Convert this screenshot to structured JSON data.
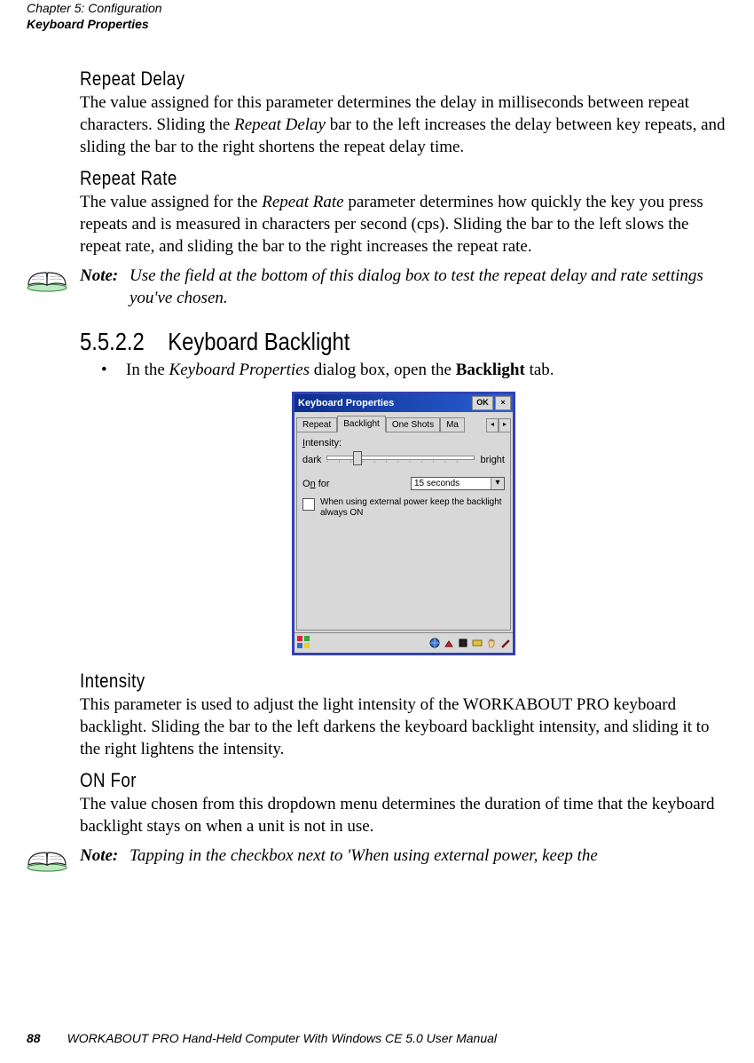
{
  "header": {
    "line1": "Chapter 5: Configuration",
    "line2": "Keyboard Properties"
  },
  "repeat_delay": {
    "heading": "Repeat Delay",
    "p1a": "The value assigned for this parameter determines the delay in milliseconds between repeat characters. Sliding the ",
    "p1_em": "Repeat Delay",
    "p1b": " bar to the left increases the delay between key repeats, and sliding the bar to the right shortens the repeat delay time."
  },
  "repeat_rate": {
    "heading": "Repeat Rate",
    "p1a": "The value assigned for the ",
    "p1_em": "Repeat Rate",
    "p1b": " parameter determines how quickly the key you press repeats and is measured in characters per second (cps). Sliding the bar to the left slows the repeat rate, and sliding the bar to the right increases the repeat rate."
  },
  "note1": {
    "label": "Note:",
    "text": "Use the field at the bottom of this dialog box to test the repeat delay and rate settings you've chosen."
  },
  "backlight_section": {
    "number": "5.5.2.2",
    "title": "Keyboard Backlight",
    "bullet_a": "In the ",
    "bullet_em": "Keyboard Properties",
    "bullet_b": " dialog box, open the ",
    "bullet_bold": "Backlight",
    "bullet_c": " tab."
  },
  "dialog": {
    "title": "Keyboard Properties",
    "ok": "OK",
    "close": "×",
    "tabs": {
      "repeat": "Repeat",
      "backlight": "Backlight",
      "oneshots": "One Shots",
      "macro": "Ma"
    },
    "intensity_label": "Intensity:",
    "dark": "dark",
    "bright": "bright",
    "onfor_label_a": "O",
    "onfor_label_u": "n",
    "onfor_label_b": " for",
    "onfor_value": "15 seconds",
    "check_text": "When using external power keep the backlight always ON"
  },
  "intensity": {
    "heading": "Intensity",
    "p": "This parameter is used to adjust the light intensity of the WORKABOUT PRO keyboard backlight. Sliding the bar to the left darkens the keyboard backlight intensity, and sliding it to the right lightens the intensity."
  },
  "onfor": {
    "heading": "ON For",
    "p": "The value chosen from this dropdown menu determines the duration of time that the keyboard backlight stays on when a unit is not in use."
  },
  "note2": {
    "label": "Note:",
    "text": "Tapping in the checkbox next to 'When using external power, keep the"
  },
  "footer": {
    "page": "88",
    "title": "WORKABOUT PRO Hand-Held Computer With Windows CE 5.0 User Manual"
  }
}
